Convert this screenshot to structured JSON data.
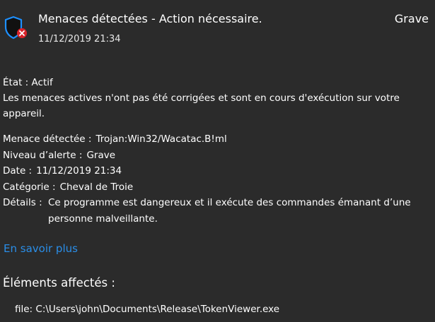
{
  "notification": {
    "title": "Menaces détectées - Action nécessaire.",
    "timestamp": "11/12/2019 21:34",
    "severity": "Grave",
    "icon": "shield-alert-icon",
    "accent_color": "#1e90ff",
    "alert_color": "#d9242b"
  },
  "status": {
    "line": "État :  Actif",
    "description": "Les menaces actives n'ont pas été corrigées et sont en cours d'exécution sur votre appareil."
  },
  "details": [
    {
      "label": "Menace détectée :",
      "value": "Trojan:Win32/Wacatac.B!ml"
    },
    {
      "label": "Niveau d’alerte :",
      "value": "Grave"
    },
    {
      "label": "Date :",
      "value": "11/12/2019 21:34"
    },
    {
      "label": "Catégorie :",
      "value": "Cheval de Troie"
    },
    {
      "label": "Détails :",
      "value": "Ce programme est dangereux et il exécute des commandes émanant d’une personne malveillante."
    }
  ],
  "learn_more": "En savoir plus",
  "affected": {
    "heading": "Éléments affectés :",
    "items": [
      "file: C:\\Users\\john\\Documents\\Release\\TokenViewer.exe"
    ]
  }
}
